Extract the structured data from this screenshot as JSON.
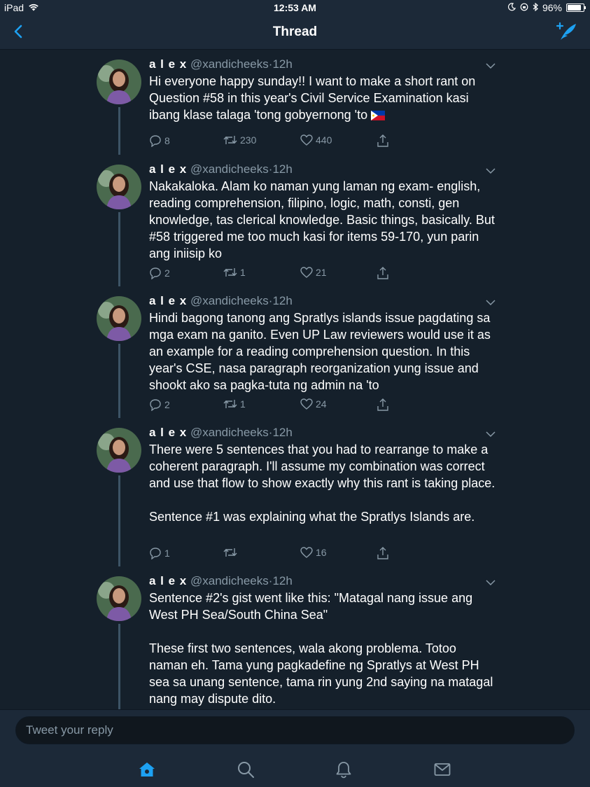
{
  "status": {
    "device": "iPad",
    "time": "12:53 AM",
    "battery": "96%",
    "battery_level": 0.96
  },
  "nav": {
    "title": "Thread"
  },
  "tweets": [
    {
      "name": "a l e x",
      "handle": "@xandicheeks",
      "sep": "·",
      "time": "12h",
      "text": "Hi everyone happy sunday!! I want to make a short rant on Question #58 in this year's Civil Service Examination kasi ibang klase talaga 'tong gobyernong 'to",
      "replies": "8",
      "retweets": "230",
      "likes": "440"
    },
    {
      "name": "a l e x",
      "handle": "@xandicheeks",
      "sep": "·",
      "time": "12h",
      "text": "Nakakaloka. Alam ko naman yung laman ng exam- english, reading comprehension, filipino, logic, math, consti, gen knowledge, tas clerical knowledge. Basic things, basically. But #58 triggered me too much kasi for items 59-170, yun parin ang iniisip ko",
      "replies": "2",
      "retweets": "1",
      "likes": "21"
    },
    {
      "name": "a l e x",
      "handle": "@xandicheeks",
      "sep": "·",
      "time": "12h",
      "text": "Hindi bagong tanong ang Spratlys islands issue pagdating sa mga exam na ganito. Even UP Law reviewers would use it as an example for a reading comprehension question. In this year's CSE, nasa paragraph reorganization yung issue and shookt ako sa pagka-tuta ng admin na 'to",
      "replies": "2",
      "retweets": "1",
      "likes": "24"
    },
    {
      "name": "a l e x",
      "handle": "@xandicheeks",
      "sep": "·",
      "time": "12h",
      "text": "There were 5 sentences that you had to rearrange to make a coherent paragraph. I'll assume my combination was correct and use that flow to show exactly why this rant is taking place.\n\nSentence #1 was explaining what the Spratlys Islands are.",
      "replies": "1",
      "retweets": "",
      "likes": "16"
    },
    {
      "name": "a l e x",
      "handle": "@xandicheeks",
      "sep": "·",
      "time": "12h",
      "text": "Sentence #2's gist went like this: \"Matagal nang issue ang West PH Sea/South China Sea\"\n\nThese first two sentences, wala akong problema. Totoo naman eh. Tama yung pagkadefine ng Spratlys at West PH sea sa unang sentence, tama rin yung 2nd saying na matagal nang may dispute dito."
    }
  ],
  "reply": {
    "placeholder": "Tweet your reply"
  },
  "colors": {
    "accent": "#1da1f2",
    "background": "#15202b",
    "bar": "#1c2938",
    "muted": "#8899a6"
  },
  "icons": [
    "back-chevron-icon",
    "compose-tweet-icon",
    "reply-icon",
    "retweet-icon",
    "like-icon",
    "share-icon",
    "philippines-flag-icon",
    "home-icon",
    "search-icon",
    "notifications-icon",
    "messages-icon"
  ]
}
